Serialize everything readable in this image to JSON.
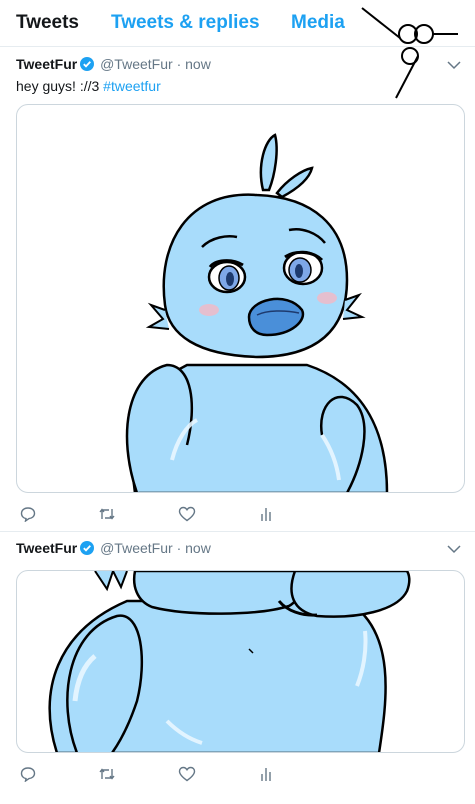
{
  "tabs": [
    {
      "label": "Tweets",
      "active": true
    },
    {
      "label": "Tweets & replies",
      "active": false
    },
    {
      "label": "Media",
      "active": false
    }
  ],
  "tweets": [
    {
      "name": "TweetFur",
      "handle": "@TweetFur",
      "separator": "·",
      "time": "now",
      "text": "hey guys! ://3 ",
      "hashtag": "#tweetfur",
      "verified": true
    },
    {
      "name": "TweetFur",
      "handle": "@TweetFur",
      "separator": "·",
      "time": "now",
      "verified": true
    }
  ],
  "icons": [
    "logo-icon",
    "verified-badge-icon",
    "chevron-down-icon",
    "reply-icon",
    "retweet-icon",
    "like-icon",
    "analytics-icon"
  ],
  "colors": {
    "accent": "#1da1f2",
    "text": "#14171a",
    "muted": "#657786",
    "character": "#a8dcfb",
    "beak": "#4a8fd9"
  }
}
